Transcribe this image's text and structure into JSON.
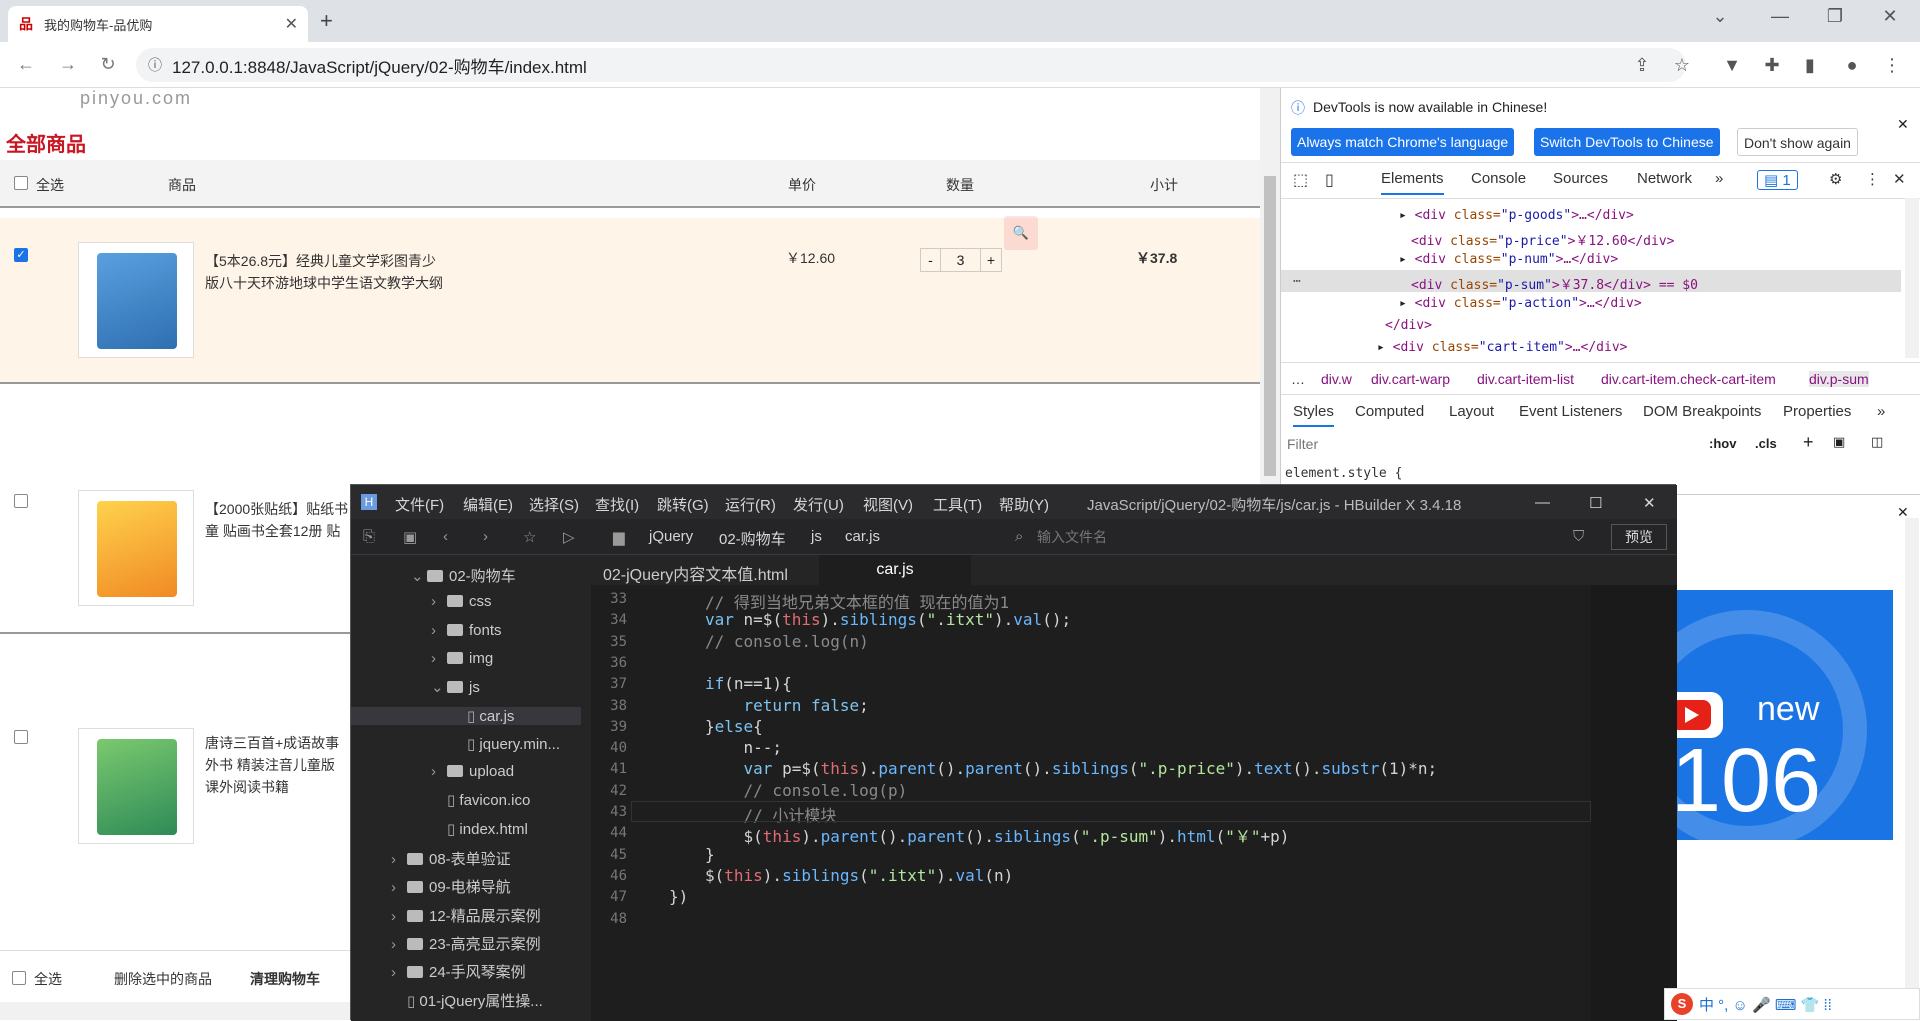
{
  "browser": {
    "tab_title": "我的购物车-品优购",
    "url": "127.0.0.1:8848/JavaScript/jQuery/02-购物车/index.html"
  },
  "page": {
    "logo_text": "pinyou.com",
    "all_goods": "全部商品",
    "header": {
      "select_all": "全选",
      "goods": "商品",
      "price": "单价",
      "qty": "数量",
      "subtotal": "小计"
    },
    "items": [
      {
        "name_line1": "【5本26.8元】经典儿童文学彩图青少",
        "name_line2": "版八十天环游地球中学生语文教学大纲",
        "price": "￥12.60",
        "qty": "3",
        "subtotal": "￥37.8",
        "checked": true
      },
      {
        "name_line1": "【2000张贴纸】贴纸书",
        "name_line2": "童 贴画书全套12册 贴",
        "price": "",
        "qty": "",
        "subtotal": "",
        "checked": false
      },
      {
        "name_line1": "唐诗三百首+成语故事",
        "name_line2": "外书 精装注音儿童版",
        "name_line3": "课外阅读书籍",
        "checked": false
      }
    ],
    "footer": {
      "select_all": "全选",
      "delete_selected": "删除选中的商品",
      "clear_cart": "清理购物车"
    },
    "qty_minus": "-",
    "qty_plus": "+"
  },
  "devtools": {
    "notice": "DevTools is now available in Chinese!",
    "btn_match": "Always match Chrome's language",
    "btn_switch": "Switch DevTools to Chinese",
    "btn_dont": "Don't show again",
    "tabs": [
      "Elements",
      "Console",
      "Sources",
      "Network"
    ],
    "issue_count": "1",
    "dom_lines": [
      {
        "tag": "<div",
        "attr": " class=",
        "val": "\"p-goods\"",
        "rest": ">…</div>"
      },
      {
        "tag": "<div",
        "attr": " class=",
        "val": "\"p-price\"",
        "rest": ">￥12.60</div>"
      },
      {
        "tag": "<div",
        "attr": " class=",
        "val": "\"p-num\"",
        "rest": ">…</div>"
      },
      {
        "tag": "<div",
        "attr": " class=",
        "val": "\"p-sum\"",
        "rest": ">￥37.8</div> == $0"
      },
      {
        "tag": "<div",
        "attr": " class=",
        "val": "\"p-action\"",
        "rest": ">…</div>"
      },
      {
        "tag": "</div>",
        "attr": "",
        "val": "",
        "rest": ""
      },
      {
        "tag": "<div",
        "attr": " class=",
        "val": "\"cart-item\"",
        "rest": ">…</div>"
      }
    ],
    "breadcrumbs": [
      "div.w",
      "div.cart-warp",
      "div.cart-item-list",
      "div.cart-item.check-cart-item",
      "div.p-sum"
    ],
    "subtabs": [
      "Styles",
      "Computed",
      "Layout",
      "Event Listeners",
      "DOM Breakpoints",
      "Properties"
    ],
    "filter_placeholder": "Filter",
    "hov": ":hov",
    "cls": ".cls",
    "element_style": "element.style {",
    "video_text_new": "new",
    "video_text_num": "106"
  },
  "hbuilder": {
    "menus": [
      "文件(F)",
      "编辑(E)",
      "选择(S)",
      "查找(I)",
      "跳转(G)",
      "运行(R)",
      "发行(U)",
      "视图(V)",
      "工具(T)",
      "帮助(Y)"
    ],
    "title": "JavaScript/jQuery/02-购物车/js/car.js - HBuilder X 3.4.18",
    "path": [
      "jQuery",
      "02-购物车",
      "js",
      "car.js"
    ],
    "file_search_placeholder": "输入文件名",
    "preview": "预览",
    "tabs": [
      "02-jQuery内容文本值.html",
      "car.js"
    ],
    "tree": [
      {
        "label": "02-购物车",
        "indent": 1,
        "open": true,
        "type": "folder"
      },
      {
        "label": "css",
        "indent": 2,
        "type": "folder"
      },
      {
        "label": "fonts",
        "indent": 2,
        "type": "folder"
      },
      {
        "label": "img",
        "indent": 2,
        "type": "folder"
      },
      {
        "label": "js",
        "indent": 2,
        "open": true,
        "type": "folder"
      },
      {
        "label": "car.js",
        "indent": 3,
        "type": "file",
        "selected": true
      },
      {
        "label": "jquery.min...",
        "indent": 3,
        "type": "file"
      },
      {
        "label": "upload",
        "indent": 2,
        "type": "folder"
      },
      {
        "label": "favicon.ico",
        "indent": 2,
        "type": "file"
      },
      {
        "label": "index.html",
        "indent": 2,
        "type": "file"
      },
      {
        "label": "08-表单验证",
        "indent": 0,
        "type": "folder"
      },
      {
        "label": "09-电梯导航",
        "indent": 0,
        "type": "folder"
      },
      {
        "label": "12-精品展示案例",
        "indent": 0,
        "type": "folder"
      },
      {
        "label": "23-高亮显示案例",
        "indent": 0,
        "type": "folder"
      },
      {
        "label": "24-手风琴案例",
        "indent": 0,
        "type": "folder"
      },
      {
        "label": "01-jQuery属性操...",
        "indent": 0,
        "type": "file"
      }
    ],
    "lines": [
      "33",
      "34",
      "35",
      "36",
      "37",
      "38",
      "39",
      "40",
      "41",
      "42",
      "43",
      "44",
      "45",
      "46",
      "47",
      "48"
    ],
    "code": [
      "// 得到当地兄弟文本框的值 现在的值为1",
      "var n=$(this).siblings(\".itxt\").val();",
      "// console.log(n)",
      "",
      "if(n==1){",
      "    return false;",
      "}else{",
      "    n--;",
      "    var p=$(this).parent().parent().siblings(\".p-price\").text().substr(1)*n;",
      "    // console.log(p)",
      "    // 小计模块",
      "    $(this).parent().parent().siblings(\".p-sum\").html(\"￥\"+p)",
      "}",
      "$(this).siblings(\".itxt\").val(n)",
      "})",
      ""
    ],
    "code_indent": [
      2,
      2,
      2,
      2,
      2,
      2,
      2,
      2,
      2,
      2,
      2,
      2,
      2,
      2,
      1,
      0
    ]
  },
  "taskbar": {
    "ime": "中 °, ☺ 🎤 ⌨ 👕 ⁞⁞"
  },
  "colors": {
    "accent": "#c81623",
    "highlight_row": "#fff4e8",
    "chrome_blue": "#1a73e8"
  }
}
